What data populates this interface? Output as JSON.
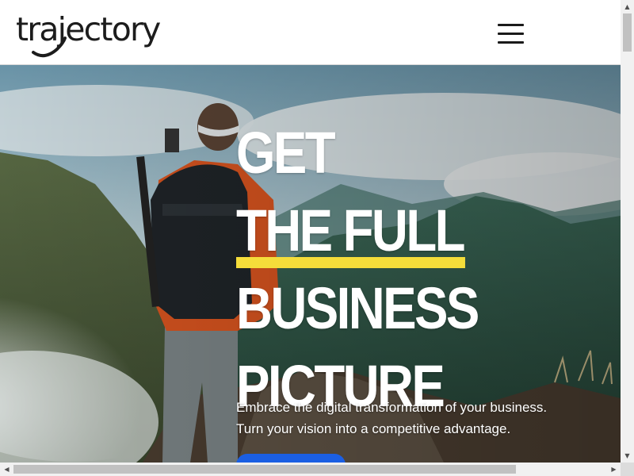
{
  "header": {
    "logo_text": "trajectory",
    "menu_icon": "hamburger-menu-icon"
  },
  "hero": {
    "headline": [
      "GET",
      "THE FULL",
      "BUSINESS",
      "PICTURE"
    ],
    "highlight_color": "#f5dd3a",
    "subtext": [
      "Embrace the digital transformation of your business.",
      "Turn your vision into a competitive advantage."
    ],
    "cta_color": "#1b5fe3",
    "background_image": "hiker-on-mountain-photo"
  },
  "scrollbars": {
    "up_icon": "scroll-up-arrow-icon",
    "down_icon": "scroll-down-arrow-icon",
    "left_icon": "scroll-left-arrow-icon",
    "right_icon": "scroll-right-arrow-icon"
  }
}
